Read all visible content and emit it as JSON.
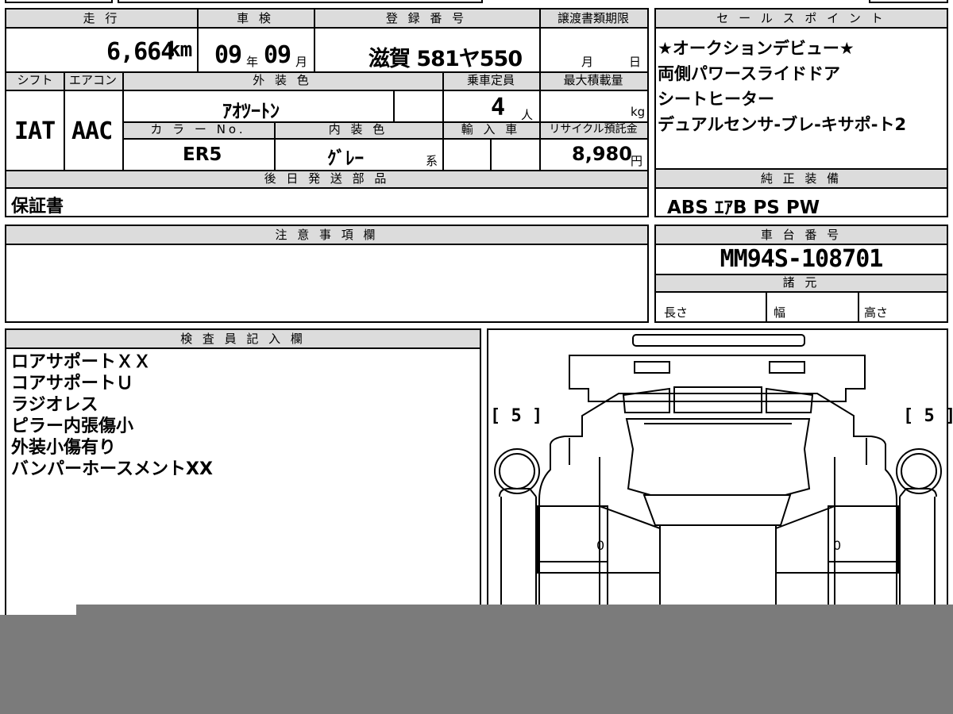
{
  "top_row": {
    "mileage_header": "走 行",
    "mileage": "6,664",
    "mileage_unit": "km",
    "inspection_header": "車 検",
    "inspection_year": "09",
    "year_unit": "年",
    "inspection_month": "09",
    "month_unit": "月",
    "registration_header": "登 録 番 号",
    "registration": "滋賀 581ヤ550",
    "transfer_header": "譲渡書類期限",
    "transfer_month_unit": "月",
    "transfer_day_unit": "日"
  },
  "second_row": {
    "shift_header": "シフト",
    "shift": "IAT",
    "ac_header": "エアコン",
    "ac": "AAC",
    "exterior_header": "外 装 色",
    "exterior": "ｱｵﾂｰﾄﾝ",
    "capacity_header": "乗車定員",
    "capacity": "4",
    "capacity_unit": "人",
    "load_header": "最大積載量",
    "load_unit": "kg",
    "color_no_header": "カ ラ ー No.",
    "color_no": "ER5",
    "interior_header": "内 装 色",
    "interior": "ｸﾞﾚｰ",
    "interior_unit": "系",
    "import_header": "輸 入 車",
    "recycle_header": "リサイクル預託金",
    "recycle": "8,980",
    "recycle_unit": "円"
  },
  "later_parts": {
    "header": "後 日 発 送 部 品",
    "value": "保証書"
  },
  "sales_points": {
    "header": "セ ー ル ス ポ イ ン ト",
    "items": [
      "★オークションデビュー★",
      "両側パワースライドドア",
      "シートヒーター",
      "デュアルセンサ-ブレ-キサポ-ト2"
    ]
  },
  "standard_equipment": {
    "header": "純 正 装 備",
    "value": "ABS ｴｱB PS PW"
  },
  "caution": {
    "header": "注 意 事 項 欄"
  },
  "chassis": {
    "header": "車 台 番 号",
    "value": "MM94S-108701"
  },
  "specs": {
    "header": "諸 元",
    "length": "長さ",
    "width": "幅",
    "height": "高さ"
  },
  "inspector": {
    "header": "検 査 員 記 入 欄",
    "notes": [
      "ロアサポートＸＸ",
      "コアサポートＵ",
      "ラジオレス",
      "ピラー内張傷小",
      "外装小傷有り",
      "バンパーホースメントXX"
    ]
  },
  "diagram": {
    "left_tire": "[ 5 ]",
    "right_tire": "[ 5 ]",
    "left_door_mark": "0",
    "right_door_mark": "0"
  }
}
